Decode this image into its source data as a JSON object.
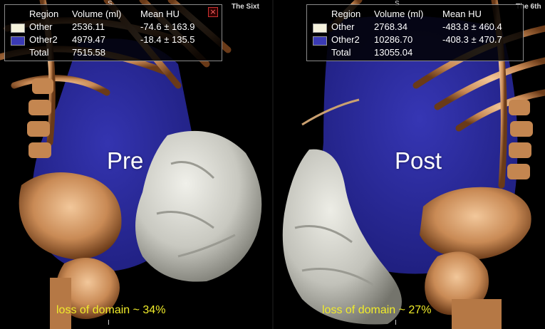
{
  "left_panel": {
    "orientation_top": "S",
    "orientation_bottom": "I",
    "series_label": "The Sixt",
    "phase_label": "Pre",
    "caption": "loss of domain ~ 34%",
    "stats": {
      "headers": {
        "region": "Region",
        "volume": "Volume (ml)",
        "mean": "Mean HU"
      },
      "rows": [
        {
          "region": "Other",
          "volume": "2536.11",
          "mean": "-74.6 ± 163.9",
          "swatch_color": "#f5f2dc"
        },
        {
          "region": "Other2",
          "volume": "4979.47",
          "mean": "-18.4 ± 135.5",
          "swatch_color": "#3a3ab4"
        }
      ],
      "total": {
        "region": "Total",
        "volume": "7515.58"
      }
    }
  },
  "right_panel": {
    "orientation_top": "S",
    "orientation_bottom": "I",
    "series_label": "The 6th",
    "phase_label": "Post",
    "caption": "loss of domain ~ 27%",
    "stats": {
      "headers": {
        "region": "Region",
        "volume": "Volume (ml)",
        "mean": "Mean HU"
      },
      "rows": [
        {
          "region": "Other",
          "volume": "2768.34",
          "mean": "-483.8 ± 460.4",
          "swatch_color": "#f5f2dc"
        },
        {
          "region": "Other2",
          "volume": "10286.70",
          "mean": "-408.3 ± 470.7",
          "swatch_color": "#3a3ab4"
        }
      ],
      "total": {
        "region": "Total",
        "volume": "13055.04"
      }
    }
  },
  "colors": {
    "visceral_blue": "#2a2a9a",
    "bone": "#d9a070",
    "hernia_gray": "#d2d2cc",
    "caption_yellow": "#f1ec2a"
  }
}
